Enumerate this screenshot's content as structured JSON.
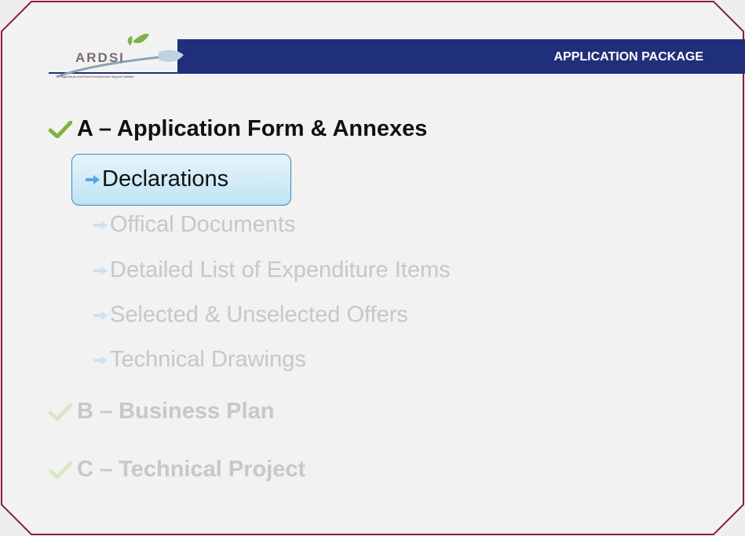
{
  "header": {
    "logo_text": "ARDSI",
    "logo_subtitle": "Agriculture and Rural Development Support Institute",
    "title": "APPLICATION PACKAGE"
  },
  "sections": [
    {
      "label": "A – Application Form & Annexes",
      "state": "active",
      "items": [
        {
          "label": "Declarations",
          "state": "current"
        },
        {
          "label": "Offical Documents",
          "state": "faded"
        },
        {
          "label": "Detailed List of Expenditure Items",
          "state": "faded"
        },
        {
          "label": "Selected & Unselected Offers",
          "state": "faded"
        },
        {
          "label": "Technical Drawings",
          "state": "faded"
        }
      ]
    },
    {
      "label": "B – Business Plan",
      "state": "faded"
    },
    {
      "label": "C – Technical Project",
      "state": "faded"
    }
  ],
  "colors": {
    "border": "#8b1f3f",
    "banner": "#1f2f7a",
    "check": "#7cb342",
    "highlight": "#bfe3f4"
  }
}
